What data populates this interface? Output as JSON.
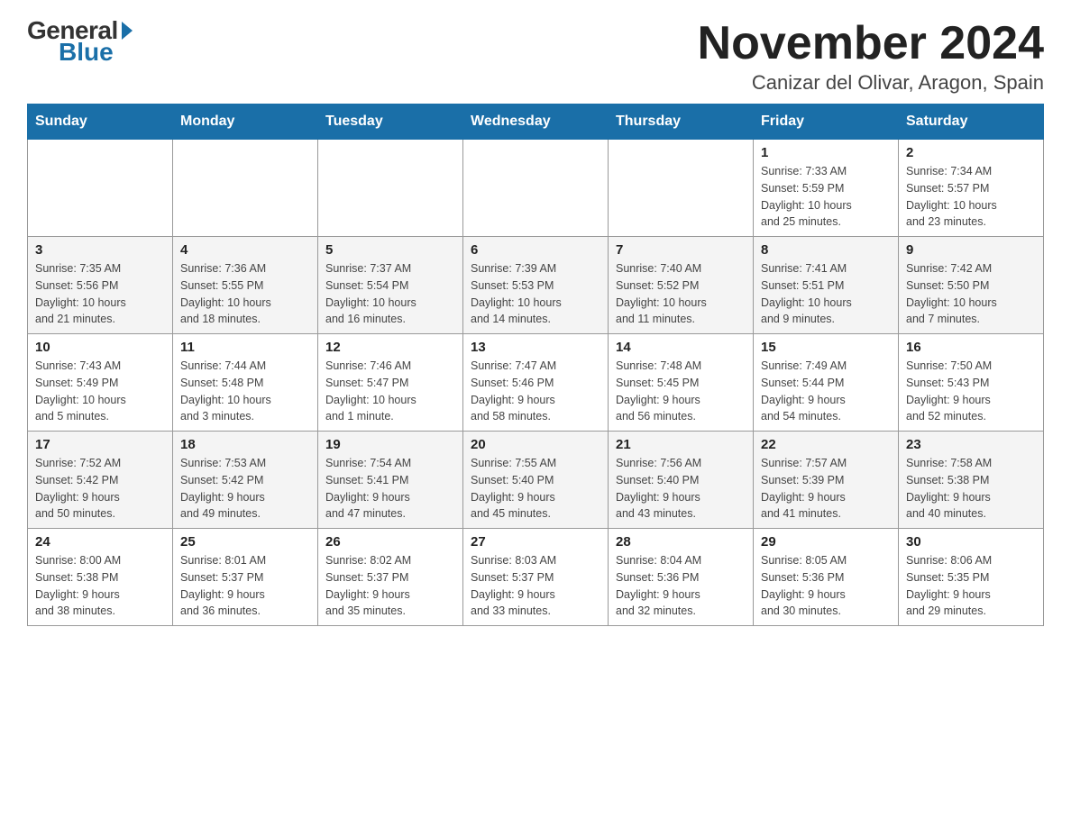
{
  "logo": {
    "general": "General",
    "blue": "Blue",
    "triangle": "▶"
  },
  "title": "November 2024",
  "location": "Canizar del Olivar, Aragon, Spain",
  "days_of_week": [
    "Sunday",
    "Monday",
    "Tuesday",
    "Wednesday",
    "Thursday",
    "Friday",
    "Saturday"
  ],
  "weeks": [
    [
      {
        "day": "",
        "info": ""
      },
      {
        "day": "",
        "info": ""
      },
      {
        "day": "",
        "info": ""
      },
      {
        "day": "",
        "info": ""
      },
      {
        "day": "",
        "info": ""
      },
      {
        "day": "1",
        "info": "Sunrise: 7:33 AM\nSunset: 5:59 PM\nDaylight: 10 hours\nand 25 minutes."
      },
      {
        "day": "2",
        "info": "Sunrise: 7:34 AM\nSunset: 5:57 PM\nDaylight: 10 hours\nand 23 minutes."
      }
    ],
    [
      {
        "day": "3",
        "info": "Sunrise: 7:35 AM\nSunset: 5:56 PM\nDaylight: 10 hours\nand 21 minutes."
      },
      {
        "day": "4",
        "info": "Sunrise: 7:36 AM\nSunset: 5:55 PM\nDaylight: 10 hours\nand 18 minutes."
      },
      {
        "day": "5",
        "info": "Sunrise: 7:37 AM\nSunset: 5:54 PM\nDaylight: 10 hours\nand 16 minutes."
      },
      {
        "day": "6",
        "info": "Sunrise: 7:39 AM\nSunset: 5:53 PM\nDaylight: 10 hours\nand 14 minutes."
      },
      {
        "day": "7",
        "info": "Sunrise: 7:40 AM\nSunset: 5:52 PM\nDaylight: 10 hours\nand 11 minutes."
      },
      {
        "day": "8",
        "info": "Sunrise: 7:41 AM\nSunset: 5:51 PM\nDaylight: 10 hours\nand 9 minutes."
      },
      {
        "day": "9",
        "info": "Sunrise: 7:42 AM\nSunset: 5:50 PM\nDaylight: 10 hours\nand 7 minutes."
      }
    ],
    [
      {
        "day": "10",
        "info": "Sunrise: 7:43 AM\nSunset: 5:49 PM\nDaylight: 10 hours\nand 5 minutes."
      },
      {
        "day": "11",
        "info": "Sunrise: 7:44 AM\nSunset: 5:48 PM\nDaylight: 10 hours\nand 3 minutes."
      },
      {
        "day": "12",
        "info": "Sunrise: 7:46 AM\nSunset: 5:47 PM\nDaylight: 10 hours\nand 1 minute."
      },
      {
        "day": "13",
        "info": "Sunrise: 7:47 AM\nSunset: 5:46 PM\nDaylight: 9 hours\nand 58 minutes."
      },
      {
        "day": "14",
        "info": "Sunrise: 7:48 AM\nSunset: 5:45 PM\nDaylight: 9 hours\nand 56 minutes."
      },
      {
        "day": "15",
        "info": "Sunrise: 7:49 AM\nSunset: 5:44 PM\nDaylight: 9 hours\nand 54 minutes."
      },
      {
        "day": "16",
        "info": "Sunrise: 7:50 AM\nSunset: 5:43 PM\nDaylight: 9 hours\nand 52 minutes."
      }
    ],
    [
      {
        "day": "17",
        "info": "Sunrise: 7:52 AM\nSunset: 5:42 PM\nDaylight: 9 hours\nand 50 minutes."
      },
      {
        "day": "18",
        "info": "Sunrise: 7:53 AM\nSunset: 5:42 PM\nDaylight: 9 hours\nand 49 minutes."
      },
      {
        "day": "19",
        "info": "Sunrise: 7:54 AM\nSunset: 5:41 PM\nDaylight: 9 hours\nand 47 minutes."
      },
      {
        "day": "20",
        "info": "Sunrise: 7:55 AM\nSunset: 5:40 PM\nDaylight: 9 hours\nand 45 minutes."
      },
      {
        "day": "21",
        "info": "Sunrise: 7:56 AM\nSunset: 5:40 PM\nDaylight: 9 hours\nand 43 minutes."
      },
      {
        "day": "22",
        "info": "Sunrise: 7:57 AM\nSunset: 5:39 PM\nDaylight: 9 hours\nand 41 minutes."
      },
      {
        "day": "23",
        "info": "Sunrise: 7:58 AM\nSunset: 5:38 PM\nDaylight: 9 hours\nand 40 minutes."
      }
    ],
    [
      {
        "day": "24",
        "info": "Sunrise: 8:00 AM\nSunset: 5:38 PM\nDaylight: 9 hours\nand 38 minutes."
      },
      {
        "day": "25",
        "info": "Sunrise: 8:01 AM\nSunset: 5:37 PM\nDaylight: 9 hours\nand 36 minutes."
      },
      {
        "day": "26",
        "info": "Sunrise: 8:02 AM\nSunset: 5:37 PM\nDaylight: 9 hours\nand 35 minutes."
      },
      {
        "day": "27",
        "info": "Sunrise: 8:03 AM\nSunset: 5:37 PM\nDaylight: 9 hours\nand 33 minutes."
      },
      {
        "day": "28",
        "info": "Sunrise: 8:04 AM\nSunset: 5:36 PM\nDaylight: 9 hours\nand 32 minutes."
      },
      {
        "day": "29",
        "info": "Sunrise: 8:05 AM\nSunset: 5:36 PM\nDaylight: 9 hours\nand 30 minutes."
      },
      {
        "day": "30",
        "info": "Sunrise: 8:06 AM\nSunset: 5:35 PM\nDaylight: 9 hours\nand 29 minutes."
      }
    ]
  ]
}
